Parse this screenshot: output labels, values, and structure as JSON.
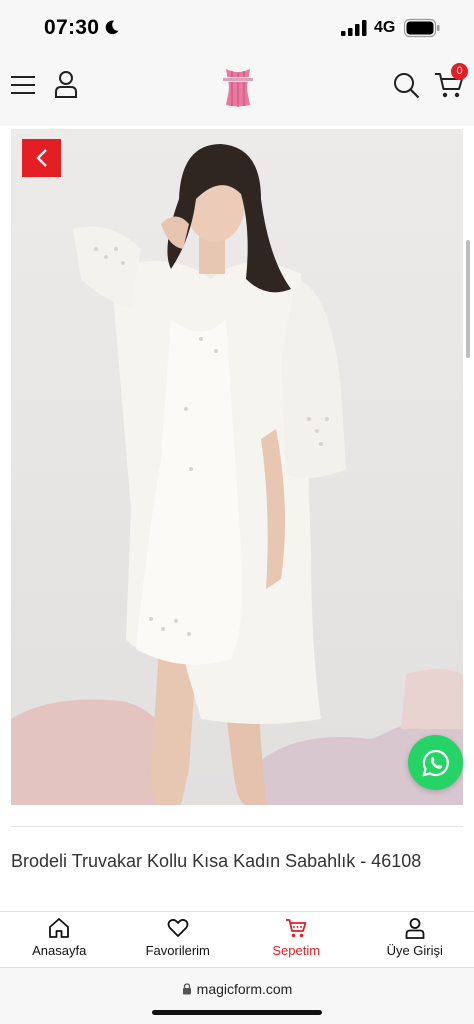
{
  "status_bar": {
    "time": "07:30",
    "network": "4G",
    "icons": [
      "moon-icon",
      "signal-icon",
      "battery-icon"
    ]
  },
  "header": {
    "cart_count": "0",
    "icons": [
      "menu-icon",
      "user-icon",
      "search-icon",
      "cart-icon"
    ]
  },
  "product": {
    "title": "Brodeli Truvakar Kollu Kısa Kadın Sabahlık - 46108"
  },
  "tab_bar": {
    "items": [
      {
        "label": "Anasayfa",
        "icon": "home-icon",
        "active": false
      },
      {
        "label": "Favorilerim",
        "icon": "heart-icon",
        "active": false
      },
      {
        "label": "Sepetim",
        "icon": "cart-icon",
        "active": true
      },
      {
        "label": "Üye Girişi",
        "icon": "user-icon",
        "active": false
      }
    ]
  },
  "browser": {
    "url": "magicform.com"
  },
  "colors": {
    "accent": "#e31e24",
    "whatsapp": "#25d366",
    "header_bg": "#f7f7f7"
  }
}
